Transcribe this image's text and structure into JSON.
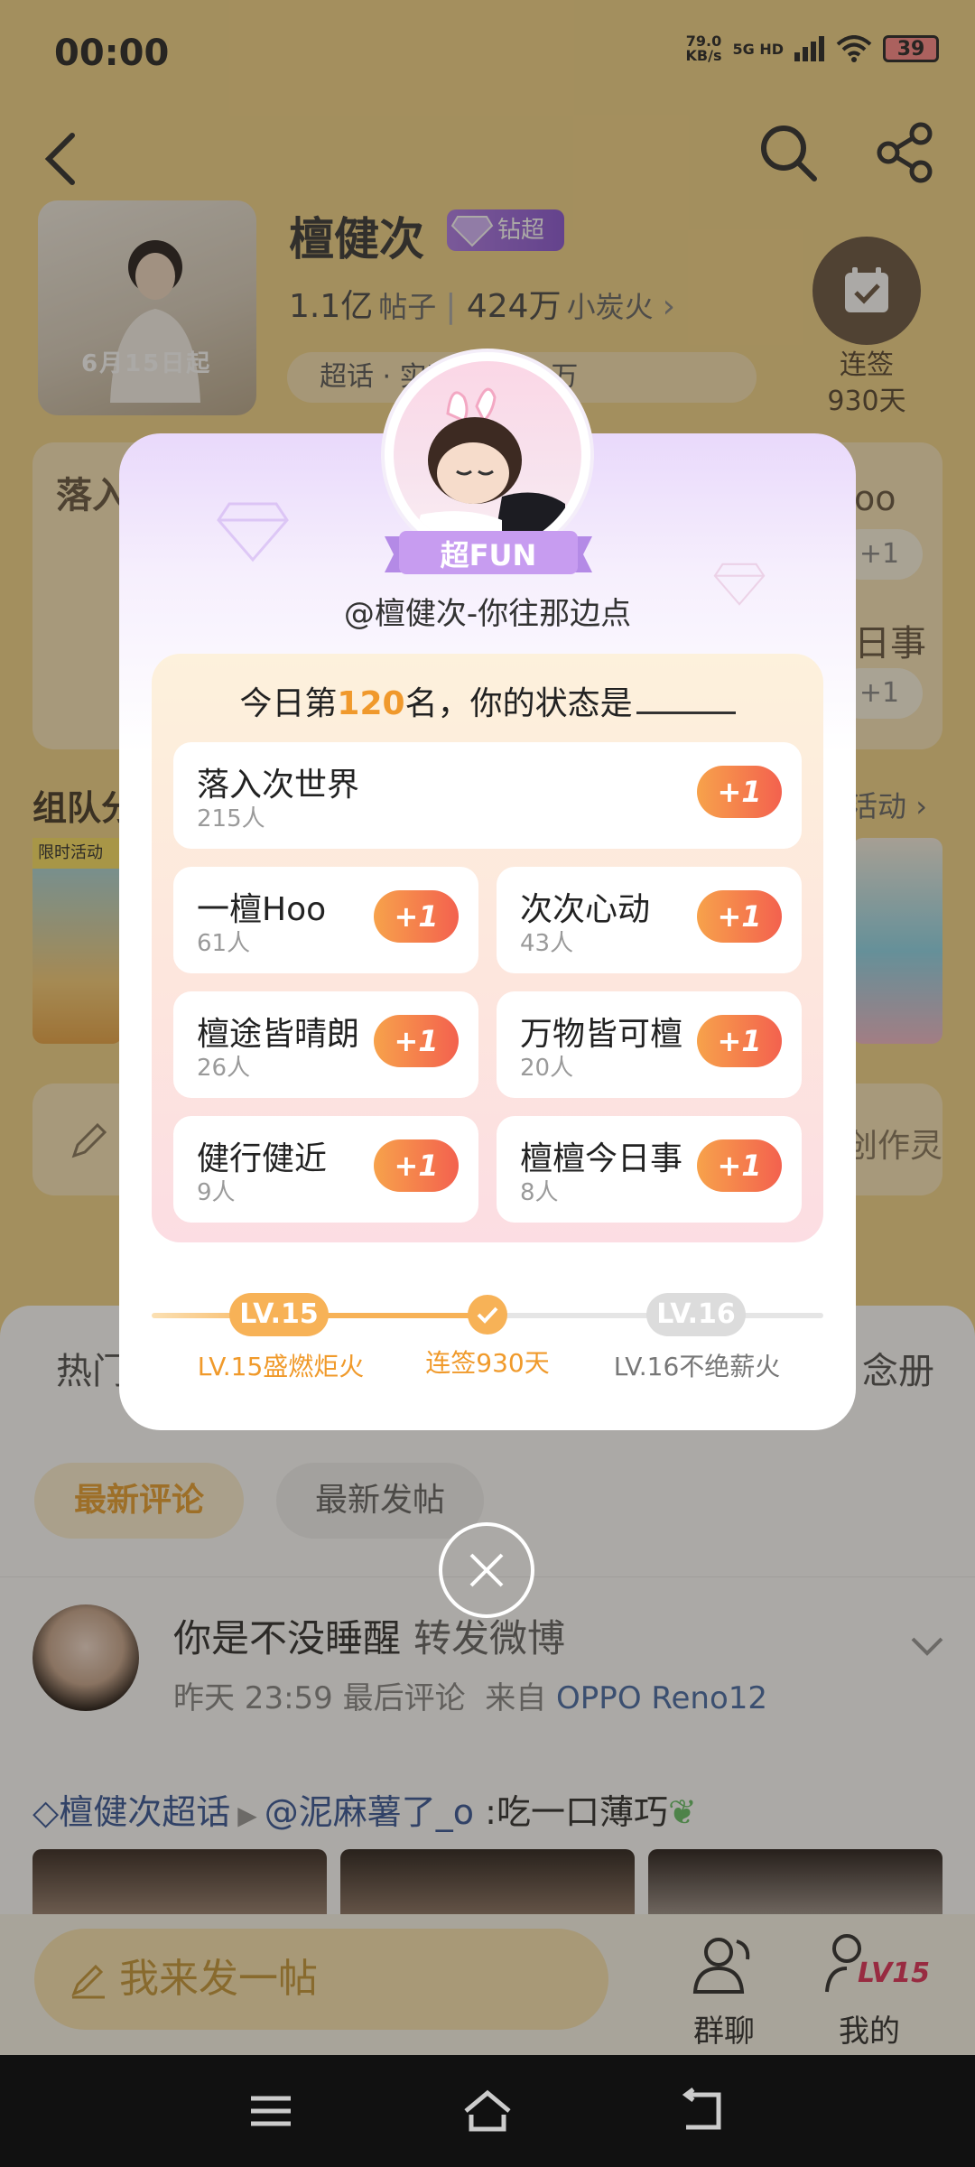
{
  "status_bar": {
    "time": "00:00",
    "speed": "79.0",
    "speed_unit": "KB/s",
    "network": "5G HD",
    "battery": "39"
  },
  "topic": {
    "title": "檀健次",
    "badge": "钻超",
    "posts_count": "1.1亿",
    "posts_label": "帖子",
    "fire_count": "424万",
    "fire_label": "小炭火",
    "rank_text": "超话 · 实时热度 92万",
    "cover_date": "6月15日起"
  },
  "checkin": {
    "label_line1": "连签",
    "label_line2": "930天"
  },
  "bg_sections": {
    "card_title": "落入",
    "card_right1": "oo",
    "card_right2": "日事",
    "plus_one": "+1",
    "team_title": "组队分",
    "team_more": "活动",
    "tile_tag": "限时活动",
    "creator_text": "创作灵"
  },
  "sheet": {
    "tab_left": "热门",
    "tab_right": "念册",
    "chip_active": "最新评论",
    "chip": "最新发帖"
  },
  "post": {
    "name": "你是不没睡醒",
    "name_sub": "转发微博",
    "meta_time": "昨天 23:59 最后评论",
    "meta_from": "来自",
    "meta_device": "OPPO Reno12",
    "topic_tag": "檀健次超话",
    "mention": "@泥麻薯了_o",
    "content": ":吃一口薄巧"
  },
  "bottom_bar": {
    "compose": "我来发一帖",
    "group_chat": "群聊",
    "mine": "我的",
    "mine_level": "LV15"
  },
  "modal": {
    "banner": "超FUN",
    "username": "@檀健次-你往那边点",
    "question_prefix": "今日第",
    "question_rank": "120",
    "question_suffix": "名，你的状态是",
    "options": [
      {
        "name": "落入次世界",
        "count": "215人",
        "plus": "+1"
      },
      {
        "name": "一檀Hoo",
        "count": "61人",
        "plus": "+1"
      },
      {
        "name": "次次心动",
        "count": "43人",
        "plus": "+1"
      },
      {
        "name": "檀途皆晴朗",
        "count": "26人",
        "plus": "+1"
      },
      {
        "name": "万物皆可檀",
        "count": "20人",
        "plus": "+1"
      },
      {
        "name": "健行健近",
        "count": "9人",
        "plus": "+1"
      },
      {
        "name": "檀檀今日事",
        "count": "8人",
        "plus": "+1"
      }
    ],
    "level": {
      "start": "LV.15",
      "end": "LV.16",
      "start_label": "LV.15盛燃炬火",
      "mid_label": "连签930天",
      "end_label": "LV.16不绝薪火",
      "progress": 0.5
    }
  },
  "colors": {
    "accent_orange": "#f0992c",
    "plus_gradient_start": "#f7a24b",
    "plus_gradient_end": "#f3614e",
    "badge_purple": "#8d5ad6",
    "link_blue": "#3a5a9a"
  }
}
